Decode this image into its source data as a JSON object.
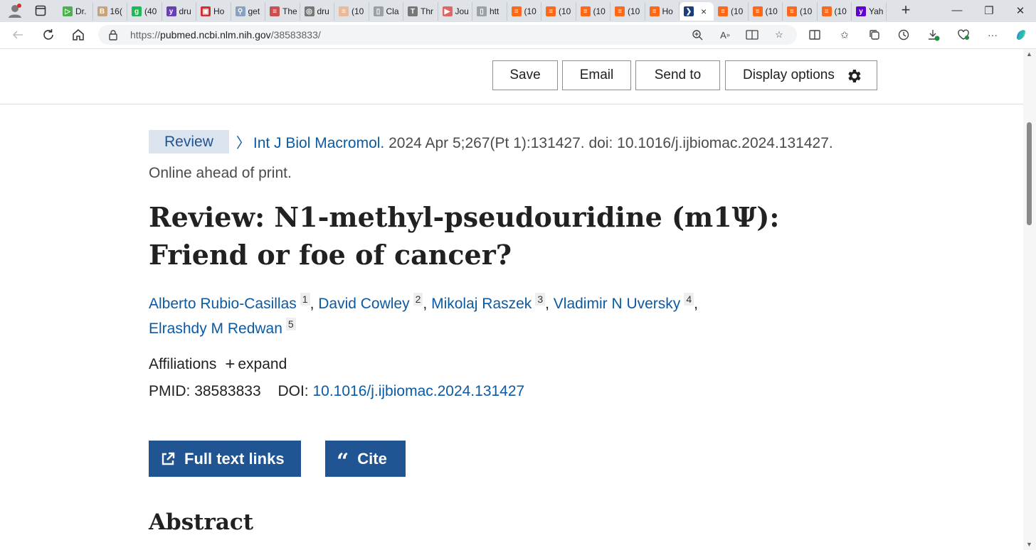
{
  "browser": {
    "tabs": [
      {
        "label": "Dr.",
        "color": "#4caf50",
        "glyph": "▷"
      },
      {
        "label": "16(",
        "color": "#c9a17a",
        "glyph": "B"
      },
      {
        "label": "(40",
        "color": "#1db954",
        "glyph": "g"
      },
      {
        "label": "dru",
        "color": "#6a3fb5",
        "glyph": "y"
      },
      {
        "label": "Ho",
        "color": "#d32f2f",
        "glyph": "▣"
      },
      {
        "label": "get",
        "color": "#8aa0c0",
        "glyph": "⚲"
      },
      {
        "label": "The",
        "color": "#c85050",
        "glyph": "≡"
      },
      {
        "label": "dru",
        "color": "#777777",
        "glyph": "◎"
      },
      {
        "label": "(10",
        "color": "#e9b99a",
        "glyph": "≡"
      },
      {
        "label": "Cla",
        "color": "#9aa0a6",
        "glyph": "▯"
      },
      {
        "label": "Thr",
        "color": "#777777",
        "glyph": "T"
      },
      {
        "label": "Jou",
        "color": "#e06666",
        "glyph": "▶"
      },
      {
        "label": "htt",
        "color": "#9aa0a6",
        "glyph": "▯"
      },
      {
        "label": "(10",
        "color": "#ff6719",
        "glyph": "≡"
      },
      {
        "label": "(10",
        "color": "#ff6719",
        "glyph": "≡"
      },
      {
        "label": "(10",
        "color": "#ff6719",
        "glyph": "≡"
      },
      {
        "label": "(10",
        "color": "#ff6719",
        "glyph": "≡"
      },
      {
        "label": "Ho",
        "color": "#ff6719",
        "glyph": "≡"
      }
    ],
    "active_tab": {
      "label": "",
      "color": "#1a3d7c"
    },
    "tabs_after": [
      {
        "label": "(10",
        "color": "#ff6719",
        "glyph": "≡"
      },
      {
        "label": "(10",
        "color": "#ff6719",
        "glyph": "≡"
      },
      {
        "label": "(10",
        "color": "#ff6719",
        "glyph": "≡"
      },
      {
        "label": "(10",
        "color": "#ff6719",
        "glyph": "≡"
      },
      {
        "label": "Yah",
        "color": "#5f01d1",
        "glyph": "y"
      }
    ],
    "url_prefix": "https://",
    "url_host": "pubmed.ncbi.nlm.nih.gov",
    "url_path": "/38583833/",
    "new_tab": "+",
    "close_tab": "×"
  },
  "actions": {
    "save": "Save",
    "email": "Email",
    "send_to": "Send to",
    "display_options": "Display options"
  },
  "article": {
    "type_badge": "Review",
    "journal": "Int J Biol Macromol.",
    "citation": " 2024 Apr 5;267(Pt 1):131427. doi: 10.1016/j.ijbiomac.2024.131427.",
    "status": "Online ahead of print.",
    "title": "Review: N1-methyl-pseudouridine (m1Ψ): Friend or foe of cancer?",
    "authors": [
      {
        "name": "Alberto Rubio-Casillas",
        "aff": "1"
      },
      {
        "name": "David Cowley",
        "aff": "2"
      },
      {
        "name": "Mikolaj Raszek",
        "aff": "3"
      },
      {
        "name": "Vladimir N Uversky",
        "aff": "4"
      },
      {
        "name": "Elrashdy M Redwan",
        "aff": "5"
      }
    ],
    "affiliations_label": "Affiliations",
    "expand_label": "expand",
    "pmid_label": "PMID:",
    "pmid": "38583833",
    "doi_label": "DOI:",
    "doi": "10.1016/j.ijbiomac.2024.131427",
    "full_text_button": "Full text links",
    "cite_button": "Cite",
    "abstract_heading": "Abstract"
  },
  "colors": {
    "link": "#0b5aa3",
    "primary_button": "#205493",
    "badge_bg": "#dce4ef"
  }
}
